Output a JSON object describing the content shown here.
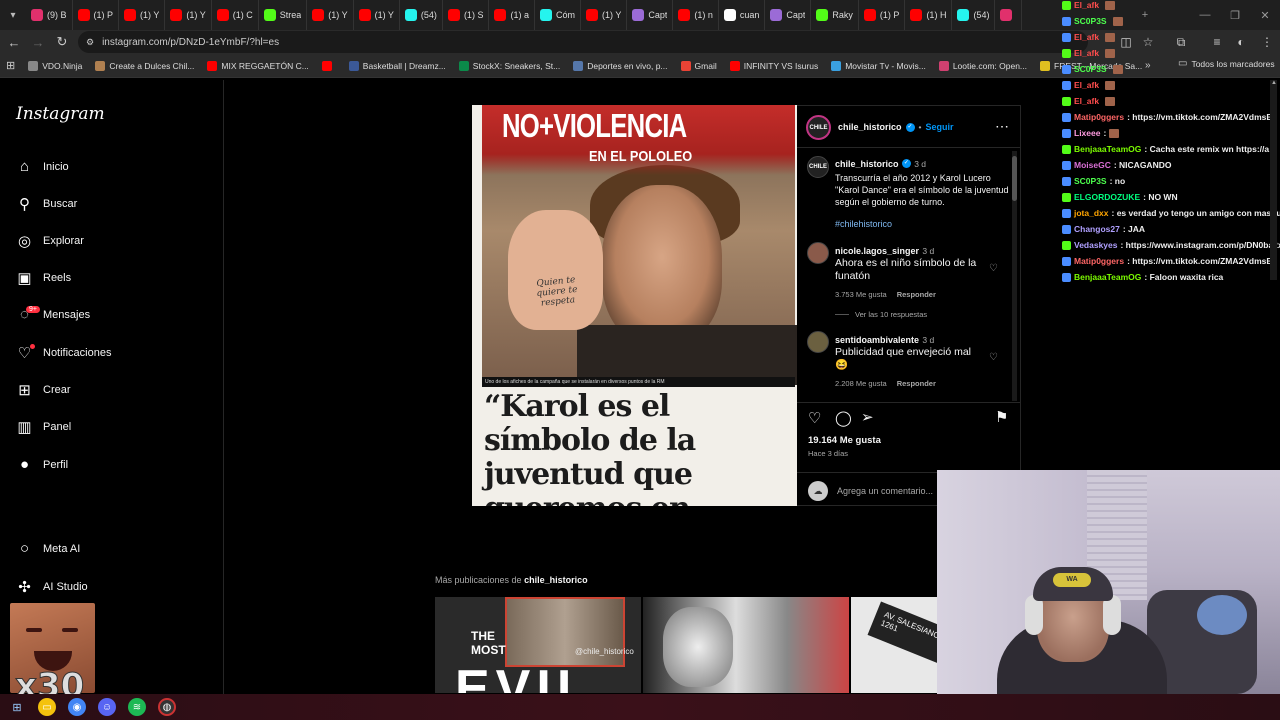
{
  "browser": {
    "tabs": [
      {
        "label": "(9) B",
        "color": "#e1306c"
      },
      {
        "label": "(1) P",
        "color": "#ff0000"
      },
      {
        "label": "(1) Y",
        "color": "#ff0000"
      },
      {
        "label": "(1) Y",
        "color": "#ff0000"
      },
      {
        "label": "(1) C",
        "color": "#ff0000"
      },
      {
        "label": "Strea",
        "color": "#53fc18"
      },
      {
        "label": "(1) Y",
        "color": "#ff0000"
      },
      {
        "label": "(1) Y",
        "color": "#ff0000"
      },
      {
        "label": "(54)",
        "color": "#25f4ee"
      },
      {
        "label": "(1) S",
        "color": "#ff0000"
      },
      {
        "label": "(1) a",
        "color": "#ff0000"
      },
      {
        "label": "Cóm",
        "color": "#25f4ee"
      },
      {
        "label": "(1) Y",
        "color": "#ff0000"
      },
      {
        "label": "Capt",
        "color": "#9b6bd6"
      },
      {
        "label": "(1) n",
        "color": "#ff0000"
      },
      {
        "label": "cuan",
        "color": "#ffffff"
      },
      {
        "label": "Capt",
        "color": "#9b6bd6"
      },
      {
        "label": "Raky",
        "color": "#53fc18"
      },
      {
        "label": "(1) P",
        "color": "#ff0000"
      },
      {
        "label": "(1) H",
        "color": "#ff0000"
      },
      {
        "label": "(54)",
        "color": "#25f4ee"
      },
      {
        "label": "",
        "color": "#e1306c"
      }
    ],
    "url": "instagram.com/p/DNzD-1eYmbF/?hl=es",
    "bookmarks": [
      {
        "label": "VDO.Ninja",
        "color": "#888888"
      },
      {
        "label": "Create a Dulces Chil...",
        "color": "#b08050"
      },
      {
        "label": "MIX REGGAETÓN C...",
        "color": "#ff0000"
      },
      {
        "label": "",
        "color": "#ff0000"
      },
      {
        "label": "Basketball | Dreamz...",
        "color": "#3b5998"
      },
      {
        "label": "StockX: Sneakers, St...",
        "color": "#0b8a4a"
      },
      {
        "label": "Deportes en vivo, p...",
        "color": "#5577aa"
      },
      {
        "label": "Gmail",
        "color": "#ea4335"
      },
      {
        "label": "INFINITY VS Isurus",
        "color": "#ff0000"
      },
      {
        "label": "Movistar Tv - Movis...",
        "color": "#3aa0e0"
      },
      {
        "label": "Lootie.com: Open...",
        "color": "#d04070"
      },
      {
        "label": "FREST - Mercado Sa...",
        "color": "#e0c020"
      }
    ],
    "bookmarks_all": "Todos los marcadores"
  },
  "sidebar": {
    "logo": "Instagram",
    "items": [
      {
        "label": "Inicio",
        "icon": "⌂"
      },
      {
        "label": "Buscar",
        "icon": "⚲"
      },
      {
        "label": "Explorar",
        "icon": "◎"
      },
      {
        "label": "Reels",
        "icon": "▣"
      },
      {
        "label": "Mensajes",
        "icon": "◌"
      },
      {
        "label": "Notificaciones",
        "icon": "♡"
      },
      {
        "label": "Crear",
        "icon": "⊞"
      },
      {
        "label": "Panel",
        "icon": "▥"
      },
      {
        "label": "Perfil",
        "icon": "●"
      },
      {
        "label": "Meta AI",
        "icon": "○"
      },
      {
        "label": "AI Studio",
        "icon": "✣"
      }
    ],
    "messages_badge": "9+"
  },
  "post": {
    "poster_title": "NO+VIOLENCIA",
    "poster_subtitle": "EN EL POLOLEO",
    "hand_text": "Quien te quiere te respeta",
    "caption_strip": "Uno de los afiches de la campaña que se instalarán en diversos puntos de la RM",
    "quote": "“Karol es el símbolo de la juventud que queremos en Chile”",
    "author": "chile_historico",
    "follow_label": "Seguir",
    "avatar_text": "CHILE",
    "caption": {
      "user": "chile_historico",
      "age": "3 d",
      "text": "Transcurría el año 2012 y Karol Lucero \"Karol Dance\" era el símbolo de la juventud según el gobierno de turno.",
      "hashtag": "#chilehistorico"
    },
    "comments": [
      {
        "user": "nicole.lagos_singer",
        "age": "3 d",
        "text": "Ahora es el niño símbolo de la funatón",
        "likes": "3.753 Me gusta",
        "reply": "Responder",
        "replies": "Ver las 10 respuestas"
      },
      {
        "user": "sentidoambivalente",
        "age": "3 d",
        "text": "Publicidad que envejeció mal 😆",
        "likes": "2.208 Me gusta",
        "reply": "Responder",
        "replies": ""
      }
    ],
    "likes_count": "19.164 Me gusta",
    "date": "Hace 3 días",
    "add_comment_placeholder": "Agrega un comentario..."
  },
  "more_posts": {
    "prefix": "Más publicaciones de",
    "user": "chile_historico",
    "thumb1_text": "THE MOST",
    "thumb1_big": "EVIL",
    "thumb1_watermark": "@chile_historico",
    "thumb3_text": "AV. SALESIANO",
    "thumb3_number": "1261"
  },
  "chat": [
    {
      "user": "El_afk",
      "color": "#ff4d4d",
      "msg": "",
      "emote": true
    },
    {
      "user": "SC0P3S",
      "color": "#4dff4d",
      "msg": "",
      "emote": true
    },
    {
      "user": "El_afk",
      "color": "#ff4d4d",
      "msg": "",
      "emote": true
    },
    {
      "user": "El_afk",
      "color": "#ff4d4d",
      "msg": "",
      "emote": true
    },
    {
      "user": "SC0P3S",
      "color": "#4dff4d",
      "msg": "",
      "emote": true
    },
    {
      "user": "El_afk",
      "color": "#ff4d4d",
      "msg": "",
      "emote": true
    },
    {
      "user": "El_afk",
      "color": "#ff4d4d",
      "msg": "",
      "emote": true
    },
    {
      "user": "Matip0ggers",
      "color": "#ff6666",
      "msg": ": https://vm.tiktok.com/ZMA2VdmsB",
      "emote": false
    },
    {
      "user": "Lixeee",
      "color": "#ff9be0",
      "msg": ":",
      "emote": true
    },
    {
      "user": "BenjaaaTeamOG",
      "color": "#7cfc00",
      "msg": ": Cacha este remix wn https://a",
      "emote": false
    },
    {
      "user": "MoiseGC",
      "color": "#da70d6",
      "msg": ": NICAGANDO",
      "emote": false
    },
    {
      "user": "SC0P3S",
      "color": "#4dff4d",
      "msg": ": no",
      "emote": false
    },
    {
      "user": "ELGORDOZUKE",
      "color": "#00ff7f",
      "msg": ": NO WN",
      "emote": false
    },
    {
      "user": "jota_dxx",
      "color": "#ffa500",
      "msg": ": es verdad yo tengo un amigo con mas fu",
      "emote": false
    },
    {
      "user": "Changos27",
      "color": "#b0a0ff",
      "msg": ": JAA",
      "emote": false
    },
    {
      "user": "Vedaskyes",
      "color": "#b0a0ff",
      "msg": ": https://www.instagram.com/p/DN0ba2x",
      "emote": false
    },
    {
      "user": "Matip0ggers",
      "color": "#ff6666",
      "msg": ": https://vm.tiktok.com/ZMA2VdmsB",
      "emote": false
    },
    {
      "user": "BenjaaaTeamOG",
      "color": "#7cfc00",
      "msg": ": Faloon waxita rica",
      "emote": false
    }
  ],
  "overlay": {
    "emote_multiplier": "x30",
    "cap_logo": "WA"
  }
}
